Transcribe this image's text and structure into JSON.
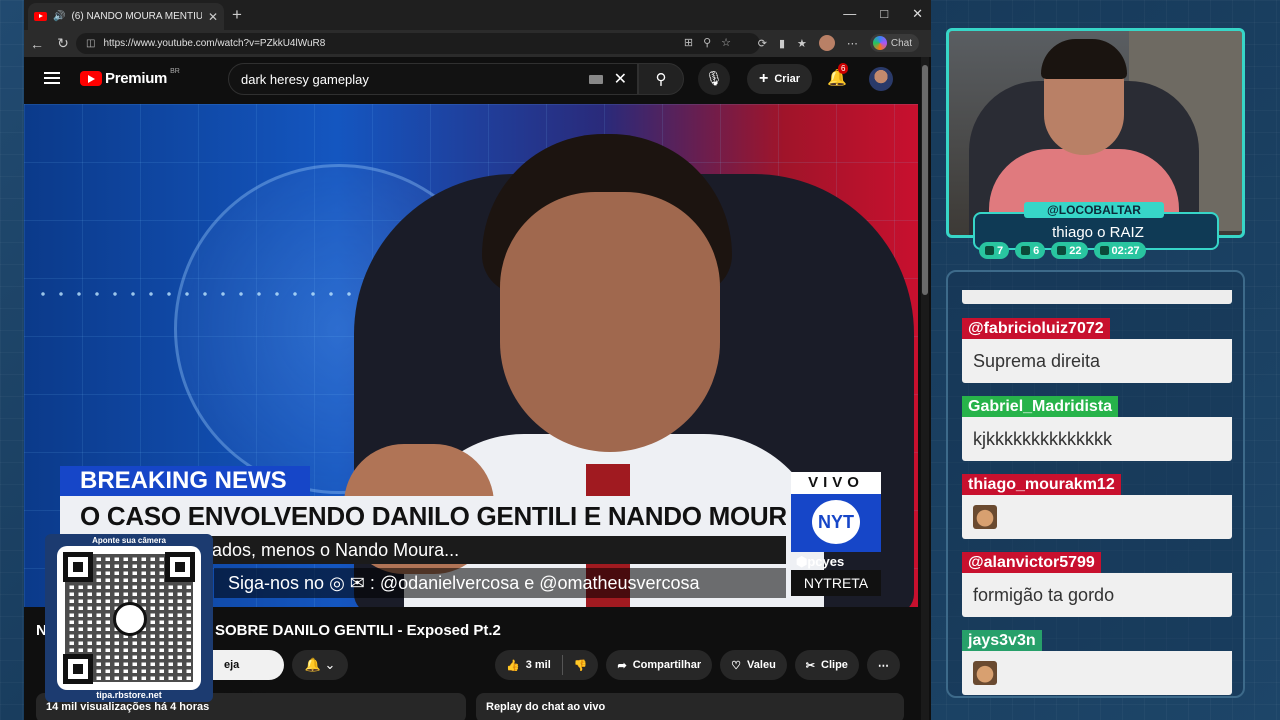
{
  "browser": {
    "tab_title": "(6) NANDO MOURA MENTIU",
    "url": "https://www.youtube.com/watch?v=PZkkU4lWuR8",
    "chat_label": "Chat"
  },
  "youtube": {
    "logo_text": "Premium",
    "logo_region": "BR",
    "search_value": "dark heresy gameplay",
    "create_label": "Criar",
    "notifications": "6"
  },
  "video": {
    "breaking": "BREAKING NEWS",
    "headline": "O CASO ENVOLVENDO DANILO GENTILI E NANDO MOURA É BIZARRO",
    "subline": "rrados, menos o Nando Moura...",
    "follow": "Siga-nos no ◎ ✉ : @odanielvercosa e @omatheusvercosa",
    "vivo": "VIVO",
    "nyt": "NYT",
    "pcyes": "⬢pcyes",
    "nytreta": "NYTRETA"
  },
  "below": {
    "title_start": "N",
    "title_end": "SOBRE DANILO GENTILI - Exposed Pt.2",
    "member": "eja membro",
    "likes": "3 mil",
    "share": "Compartilhar",
    "thanks": "Valeu",
    "clip": "Clipe",
    "views": "14 mil visualizações  há 4 horas",
    "replay": "Replay do chat ao vivo"
  },
  "qr": {
    "top": "Aponte sua câmera",
    "bottom": "tipa.rbstore.net"
  },
  "streamer": {
    "handle": "@LOCOBALTAR",
    "name": "thiago o RAIZ",
    "stats": [
      "7",
      "6",
      "22",
      "02:27"
    ],
    "stat_colors": [
      "#29c5a0",
      "#29c5a0",
      "#29c5a0",
      "#29c5a0"
    ]
  },
  "chat": [
    {
      "user": "@fabricioluiz7072",
      "text": "Suprema direita",
      "color": "#c8102e"
    },
    {
      "user": "Gabriel_Madridista",
      "text": "kjkkkkkkkkkkkkkk",
      "color": "#27b34a"
    },
    {
      "user": "thiago_mourakm12",
      "text": "",
      "color": "#c8102e"
    },
    {
      "user": "@alanvictor5799",
      "text": "formigão ta gordo",
      "color": "#c8102e"
    },
    {
      "user": "jays3v3n",
      "text": "",
      "color": "#27a06a"
    }
  ]
}
